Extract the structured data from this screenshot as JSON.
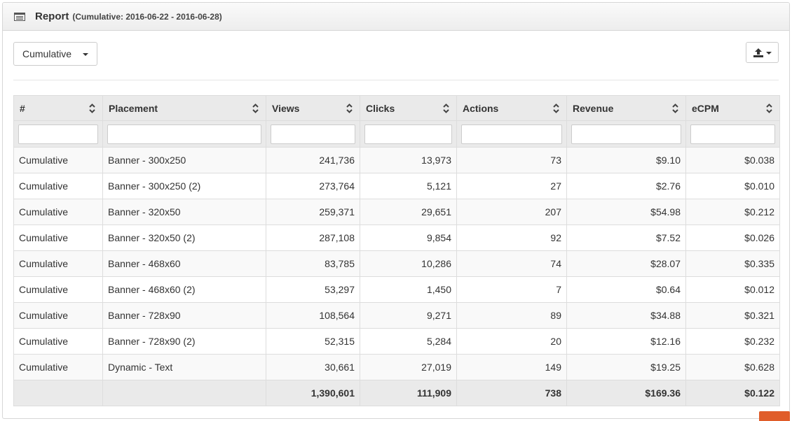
{
  "header": {
    "title": "Report",
    "subtitle": "(Cumulative: 2016-06-22 - 2016-06-28)"
  },
  "toolbar": {
    "view_dropdown": "Cumulative",
    "export_icon": "upload-icon"
  },
  "table": {
    "columns": [
      "#",
      "Placement",
      "Views",
      "Clicks",
      "Actions",
      "Revenue",
      "eCPM"
    ],
    "rows": [
      [
        "Cumulative",
        "Banner - 300x250",
        "241,736",
        "13,973",
        "73",
        "$9.10",
        "$0.038"
      ],
      [
        "Cumulative",
        "Banner - 300x250 (2)",
        "273,764",
        "5,121",
        "27",
        "$2.76",
        "$0.010"
      ],
      [
        "Cumulative",
        "Banner - 320x50",
        "259,371",
        "29,651",
        "207",
        "$54.98",
        "$0.212"
      ],
      [
        "Cumulative",
        "Banner - 320x50 (2)",
        "287,108",
        "9,854",
        "92",
        "$7.52",
        "$0.026"
      ],
      [
        "Cumulative",
        "Banner - 468x60",
        "83,785",
        "10,286",
        "74",
        "$28.07",
        "$0.335"
      ],
      [
        "Cumulative",
        "Banner - 468x60 (2)",
        "53,297",
        "1,450",
        "7",
        "$0.64",
        "$0.012"
      ],
      [
        "Cumulative",
        "Banner - 728x90",
        "108,564",
        "9,271",
        "89",
        "$34.88",
        "$0.321"
      ],
      [
        "Cumulative",
        "Banner - 728x90 (2)",
        "52,315",
        "5,284",
        "20",
        "$12.16",
        "$0.232"
      ],
      [
        "Cumulative",
        "Dynamic - Text",
        "30,661",
        "27,019",
        "149",
        "$19.25",
        "$0.628"
      ]
    ],
    "totals": [
      "",
      "",
      "1,390,601",
      "111,909",
      "738",
      "$169.36",
      "$0.122"
    ]
  },
  "colors": {
    "header_bg": "#eaeaea",
    "row_alt_bg": "#f9f9f9",
    "accent_tab": "#e05d2a"
  }
}
